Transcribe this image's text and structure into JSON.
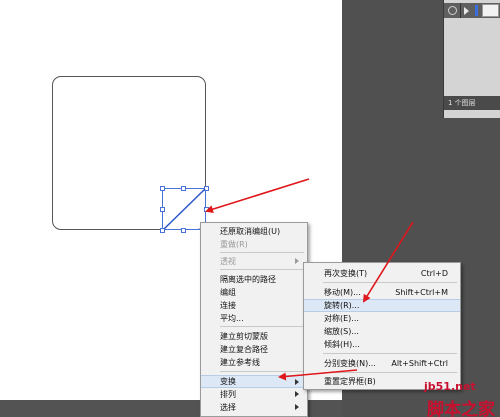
{
  "layers_panel": {
    "footer_text": "1 个图层"
  },
  "context_menu": {
    "items": [
      {
        "label": "还原取消编组(U)",
        "disabled": false
      },
      {
        "label": "重做(R)",
        "disabled": true
      },
      {
        "label": "透视",
        "disabled": true,
        "submenu": true
      },
      {
        "label": "隔离选中的路径",
        "disabled": false
      },
      {
        "label": "编组",
        "disabled": false
      },
      {
        "label": "连接",
        "disabled": false
      },
      {
        "label": "平均...",
        "disabled": false
      },
      {
        "label": "建立剪切蒙版",
        "disabled": false
      },
      {
        "label": "建立复合路径",
        "disabled": false
      },
      {
        "label": "建立参考线",
        "disabled": false
      },
      {
        "label": "变换",
        "disabled": false,
        "submenu": true,
        "highlighted": true
      },
      {
        "label": "排列",
        "disabled": false,
        "submenu": true
      },
      {
        "label": "选择",
        "disabled": false,
        "submenu": true
      }
    ]
  },
  "transform_submenu": {
    "items": [
      {
        "label": "再次变换(T)",
        "shortcut": "Ctrl+D"
      },
      {
        "label": "移动(M)...",
        "shortcut": "Shift+Ctrl+M"
      },
      {
        "label": "旋转(R)...",
        "shortcut": "",
        "highlighted": true
      },
      {
        "label": "对称(E)...",
        "shortcut": ""
      },
      {
        "label": "缩放(S)...",
        "shortcut": ""
      },
      {
        "label": "倾斜(H)...",
        "shortcut": ""
      },
      {
        "label": "分别变换(N)...",
        "shortcut": "Alt+Shift+Ctrl"
      },
      {
        "label": "重置定界框(B)",
        "shortcut": ""
      }
    ]
  },
  "watermark": {
    "domain": "jb51.net",
    "site": "脚本之家"
  },
  "colors": {
    "selection": "#4a73d9",
    "annotation_arrow": "#e0161a",
    "highlight": "#dde8f6"
  }
}
